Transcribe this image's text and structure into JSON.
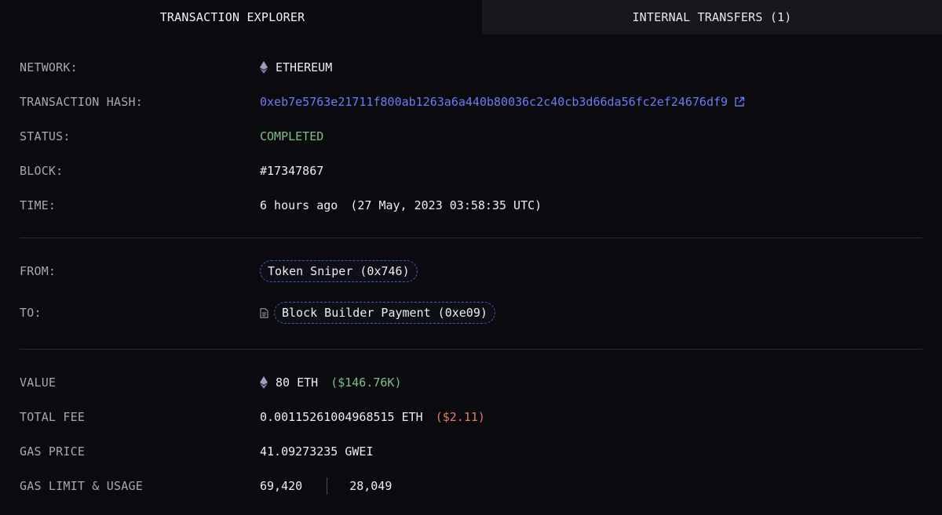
{
  "tabs": {
    "explorer_label": "TRANSACTION EXPLORER",
    "internal_label": "INTERNAL TRANSFERS (1)"
  },
  "network": {
    "label": "NETWORK:",
    "value": "ETHEREUM",
    "icon": "ethereum-icon"
  },
  "tx_hash": {
    "label": "TRANSACTION HASH:",
    "value": "0xeb7e5763e21711f800ab1263a6a440b80036c2c40cb3d66da56fc2ef24676df9",
    "icon": "external-link-icon"
  },
  "status": {
    "label": "STATUS:",
    "value": "COMPLETED"
  },
  "block": {
    "label": "BLOCK:",
    "value": "#17347867"
  },
  "time": {
    "label": "TIME:",
    "relative": "6 hours ago",
    "absolute": "(27 May, 2023 03:58:35 UTC)"
  },
  "from": {
    "label": "FROM:",
    "value": "Token Sniper (0x746)"
  },
  "to": {
    "label": "TO:",
    "value": "Block Builder Payment (0xe09)",
    "icon": "contract-document-icon"
  },
  "value_row": {
    "label": "VALUE",
    "amount": "80 ETH",
    "usd": "($146.76K)"
  },
  "total_fee": {
    "label": "TOTAL FEE",
    "amount": "0.00115261004968515 ETH",
    "usd": "($2.11)"
  },
  "gas_price": {
    "label": "GAS PRICE",
    "value": "41.09273235 GWEI"
  },
  "gas_limit": {
    "label": "GAS LIMIT & USAGE",
    "limit": "69,420",
    "usage": "28,049"
  },
  "colors": {
    "background": "#0b0b0f",
    "inactive_tab": "#17171c",
    "label": "#a7a7b1",
    "link": "#6b7cf6",
    "success": "#7fbf86",
    "fee": "#e07a6a",
    "pill_border": "#3d5bb8"
  }
}
